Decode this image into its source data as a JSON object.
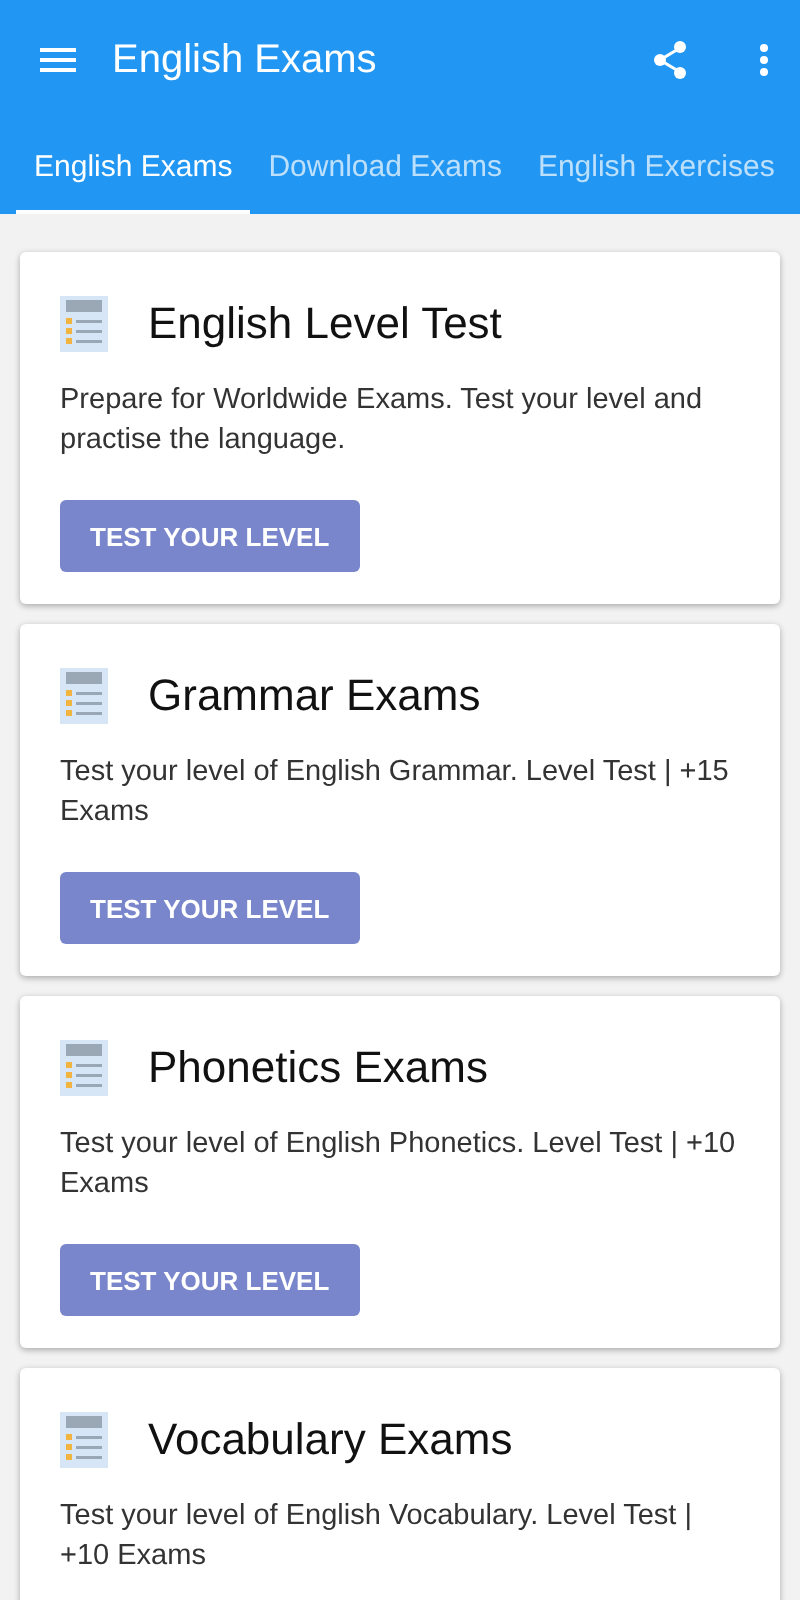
{
  "app_bar": {
    "title": "English Exams"
  },
  "tabs": [
    {
      "label": "English Exams",
      "selected": true
    },
    {
      "label": "Download Exams",
      "selected": false
    },
    {
      "label": "English Exercises",
      "selected": false
    }
  ],
  "cards": [
    {
      "title": "English Level Test",
      "description": "Prepare for Worldwide Exams. Test your level and practise the language.",
      "button": "TEST YOUR LEVEL"
    },
    {
      "title": "Grammar Exams",
      "description": "Test your level of English Grammar. Level Test | +15 Exams",
      "button": "TEST YOUR LEVEL"
    },
    {
      "title": "Phonetics Exams",
      "description": "Test your level of English Phonetics. Level Test | +10 Exams",
      "button": "TEST YOUR LEVEL"
    },
    {
      "title": "Vocabulary Exams",
      "description": "Test your level of English Vocabulary. Level Test | +10 Exams"
    }
  ]
}
